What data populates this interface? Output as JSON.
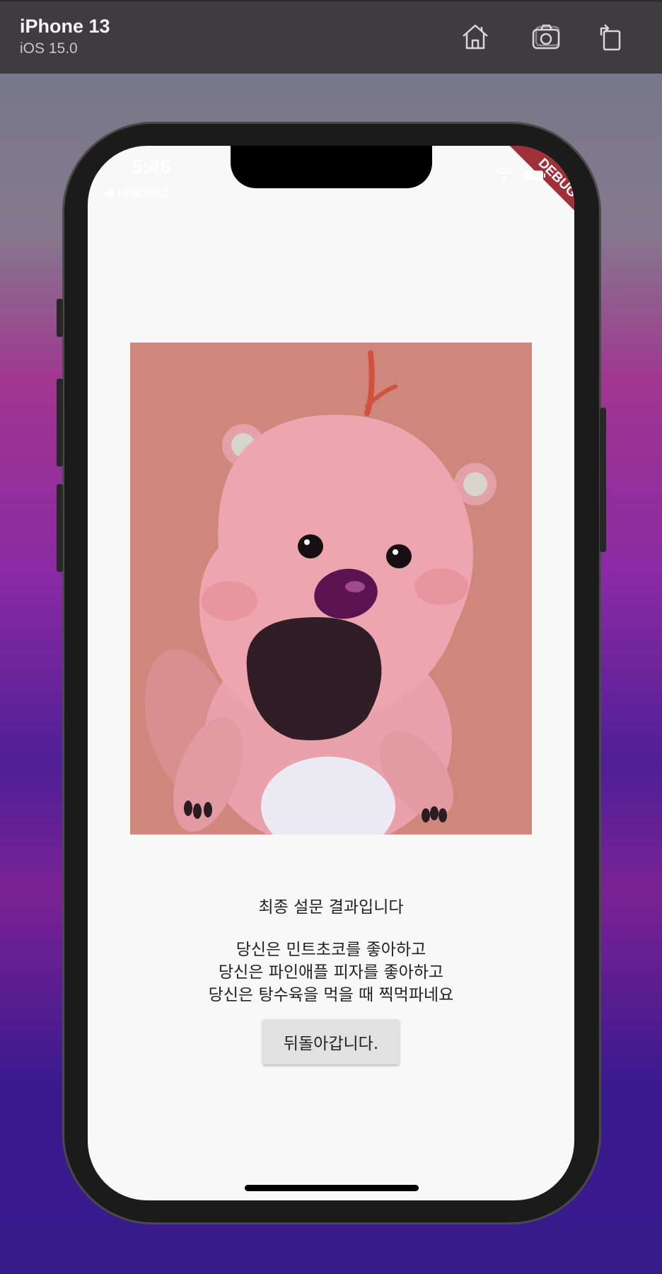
{
  "simulator": {
    "device_name": "iPhone 13",
    "os_version": "iOS 15.0",
    "toolbar_icons": [
      "home-icon",
      "screenshot-icon",
      "rotate-icon"
    ]
  },
  "status_bar": {
    "time": "5:46",
    "back_label": "◀ untitled2",
    "debug_banner": "DEBUG"
  },
  "result": {
    "image_subject": "pink cartoon beaver shouting",
    "title": "최종 설문 결과입니다",
    "lines": [
      "당신은 민트초코를 좋아하고",
      "당신은 파인애플 피자를 좋아하고",
      "당신은 탕수육을 먹을 때 찍먹파네요"
    ],
    "back_button": "뒤돌아갑니다."
  },
  "colors": {
    "toolbar_bg": "#403b40",
    "screen_bg": "#f8f8f9",
    "image_bg": "#cf877b",
    "button_bg": "#e1e1e1",
    "debug_ribbon": "#a02f3a"
  }
}
